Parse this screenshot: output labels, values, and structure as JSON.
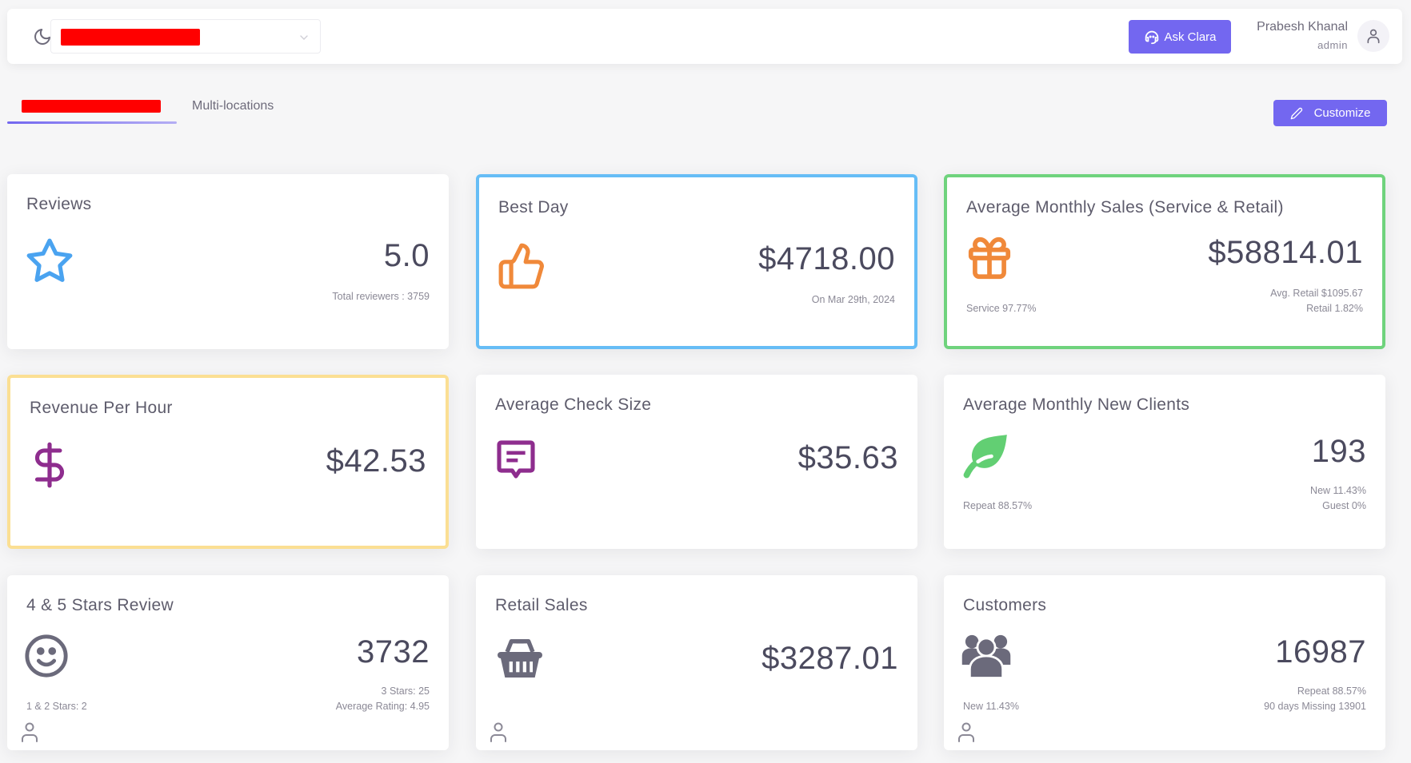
{
  "header": {
    "location_select": {
      "value": "[redacted]",
      "redacted": true
    },
    "ask_button_label": "Ask Clara",
    "user": {
      "name": "Prabesh Khanal",
      "role": "admin"
    }
  },
  "tabs": [
    {
      "label": "[redacted]",
      "redacted": true,
      "active": true
    },
    {
      "label": "Multi-locations",
      "active": false
    }
  ],
  "toolbar": {
    "customize_label": "Customize"
  },
  "colors": {
    "accent": "#7367f0",
    "blue_border": "#66bdf6",
    "green_border": "#6fd37d",
    "yellow_border": "#fbdf93",
    "icon_blue": "#4aa3f0",
    "icon_orange": "#f0893a",
    "icon_purple": "#8e2d8e",
    "icon_green": "#62cf73",
    "icon_gray": "#6b6a7b"
  },
  "cards": {
    "reviews": {
      "title": "Reviews",
      "icon": "star-icon",
      "value": "5.0",
      "total_reviewers": "Total reviewers : 3759"
    },
    "best_day": {
      "title": "Best Day",
      "icon": "thumbs-up-icon",
      "value": "$4718.00",
      "date": "On Mar 29th, 2024"
    },
    "avg_monthly_sales": {
      "title": "Average Monthly Sales (Service & Retail)",
      "icon": "gift-icon",
      "value": "$58814.01",
      "service": "Service 97.77%",
      "avg_retail": "Avg. Retail $1095.67",
      "retail": "Retail 1.82%"
    },
    "revenue_per_hour": {
      "title": "Revenue Per Hour",
      "icon": "dollar-icon",
      "value": "$42.53"
    },
    "avg_check_size": {
      "title": "Average Check Size",
      "icon": "message-icon",
      "value": "$35.63"
    },
    "avg_monthly_new_clients": {
      "title": "Average Monthly New Clients",
      "icon": "leaf-icon",
      "value": "193",
      "repeat": "Repeat 88.57%",
      "new": "New 11.43%",
      "guest": "Guest 0%"
    },
    "four_five_stars": {
      "title": "4 & 5 Stars Review",
      "icon": "smile-icon",
      "value": "3732",
      "one_two_stars": "1 & 2 Stars: 2",
      "three_stars": "3 Stars: 25",
      "avg_rating": "Average Rating: 4.95"
    },
    "retail_sales": {
      "title": "Retail Sales",
      "icon": "basket-icon",
      "value": "$3287.01"
    },
    "customers": {
      "title": "Customers",
      "icon": "users-icon",
      "value": "16987",
      "new": "New 11.43%",
      "repeat": "Repeat 88.57%",
      "missing": "90 days Missing 13901"
    }
  }
}
